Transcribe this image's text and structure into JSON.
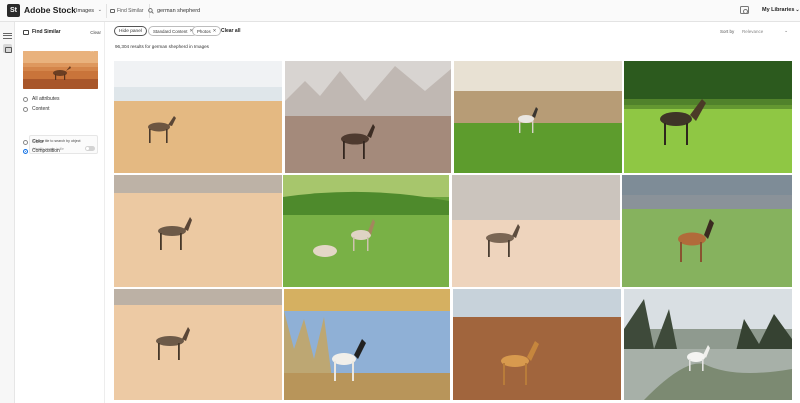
{
  "header": {
    "logo_text": "St",
    "brand": "Adobe Stock",
    "asset_type": "Images",
    "find_similar": "Find Similar",
    "search_value": "german shepherd",
    "libraries": "My Libraries"
  },
  "panel": {
    "title": "Find Similar",
    "clear": "Clear",
    "options": {
      "all_attributes": "All attributes",
      "content": "Content",
      "color": "Color",
      "composition": "Composition"
    },
    "hint": "Click a tile to search by object",
    "hint_sub": "Identify people in tile"
  },
  "filters": {
    "hide_panel": "Hide panel",
    "chips": [
      "Standard Content",
      "Photos"
    ],
    "clear_all": "Clear all",
    "sort_label": "Sort by",
    "sort_value": "Relevance"
  },
  "results": {
    "count_text": "96,304 results for german shepherd in Images"
  },
  "icons": {
    "filter": "filter-icon",
    "visual_search": "visual-search-icon",
    "camera": "camera-icon",
    "search": "search-icon"
  },
  "colors": {
    "accent": "#1473e6",
    "logo_bg": "#2b2b2b"
  }
}
